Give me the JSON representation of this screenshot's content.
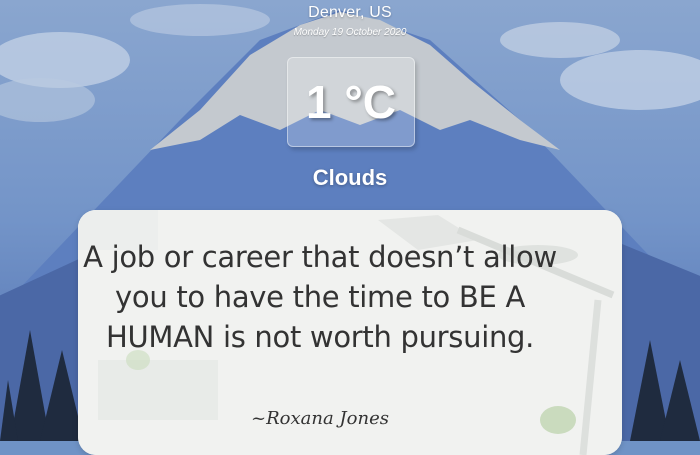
{
  "weather": {
    "location": "Denver, US",
    "date": "Monday 19 October 2020",
    "temperature": "1 °C",
    "condition": "Clouds"
  },
  "quote": {
    "text": "A job or career that doesn’t allow you to have the time to BE A HUMAN is not worth pursuing.",
    "author": "~Roxana Jones"
  },
  "colors": {
    "sky": "#6f93c6",
    "mountain": "#5d7fbf",
    "snow": "#c4c9cf",
    "text": "#ffffff",
    "quote_text": "#333333"
  }
}
